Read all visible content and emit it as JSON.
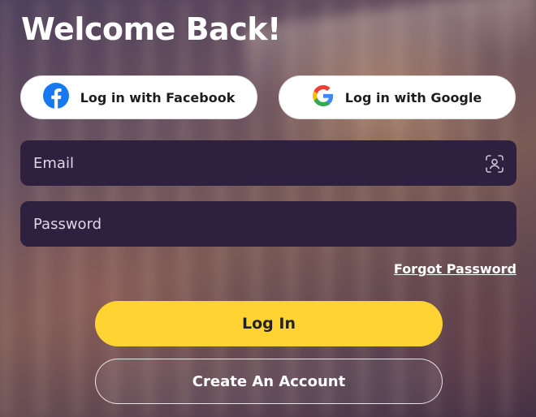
{
  "header": {
    "title": "Welcome Back!"
  },
  "social": {
    "facebook_label": "Log in with Facebook",
    "google_label": "Log in with Google"
  },
  "form": {
    "email_placeholder": "Email",
    "password_placeholder": "Password",
    "forgot_password": "Forgot Password"
  },
  "actions": {
    "login_label": "Log In",
    "create_account_label": "Create An Account"
  },
  "colors": {
    "accent_yellow": "#ffd332",
    "field_background": "#2e213f",
    "facebook_blue": "#1877f2"
  },
  "icons": {
    "facebook": "facebook-icon",
    "google": "google-icon",
    "email_field": "face-id-icon"
  }
}
